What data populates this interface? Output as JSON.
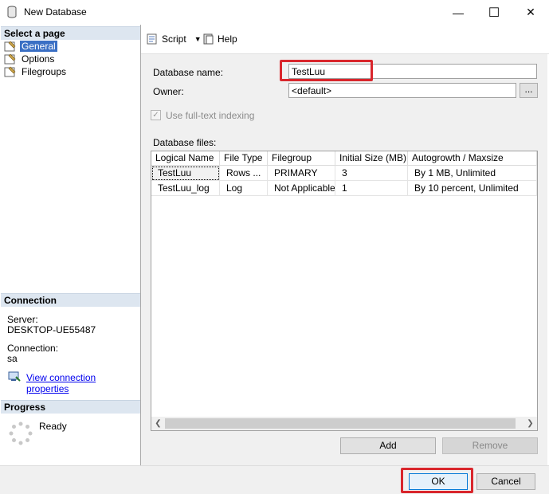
{
  "window": {
    "title": "New Database",
    "minimize_glyph": "—",
    "maximize_glyph": "☐",
    "close_glyph": "✕"
  },
  "left": {
    "select_page_header": "Select a page",
    "pages": [
      {
        "label": "General",
        "selected": true,
        "icon": "page-wrench-icon"
      },
      {
        "label": "Options",
        "selected": false,
        "icon": "page-wrench-icon"
      },
      {
        "label": "Filegroups",
        "selected": false,
        "icon": "page-wrench-icon"
      }
    ],
    "connection_header": "Connection",
    "server_label": "Server:",
    "server_value": "DESKTOP-UE55487",
    "connection_label": "Connection:",
    "connection_value": "sa",
    "view_connection_link": "View connection properties",
    "progress_header": "Progress",
    "progress_status": "Ready"
  },
  "toolbar": {
    "script_label": "Script",
    "help_label": "Help"
  },
  "form": {
    "db_name_label": "Database name:",
    "db_name_value": "TestLuu",
    "owner_label": "Owner:",
    "owner_value": "<default>",
    "browse_label": "...",
    "fulltext_label": "Use full-text indexing",
    "fulltext_checked": true,
    "db_files_label": "Database files:"
  },
  "grid": {
    "columns": [
      "Logical Name",
      "File Type",
      "Filegroup",
      "Initial Size (MB)",
      "Autogrowth / Maxsize"
    ],
    "rows": [
      [
        "TestLuu",
        "Rows ...",
        "PRIMARY",
        "3",
        "By 1 MB, Unlimited"
      ],
      [
        "TestLuu_log",
        "Log",
        "Not Applicable",
        "1",
        "By 10 percent, Unlimited"
      ]
    ]
  },
  "buttons": {
    "add": "Add",
    "remove": "Remove",
    "ok": "OK",
    "cancel": "Cancel"
  },
  "colors": {
    "highlight_red": "#d9262c",
    "selection_blue": "#3a6fc4",
    "section_header_bg": "#dde6f0"
  }
}
